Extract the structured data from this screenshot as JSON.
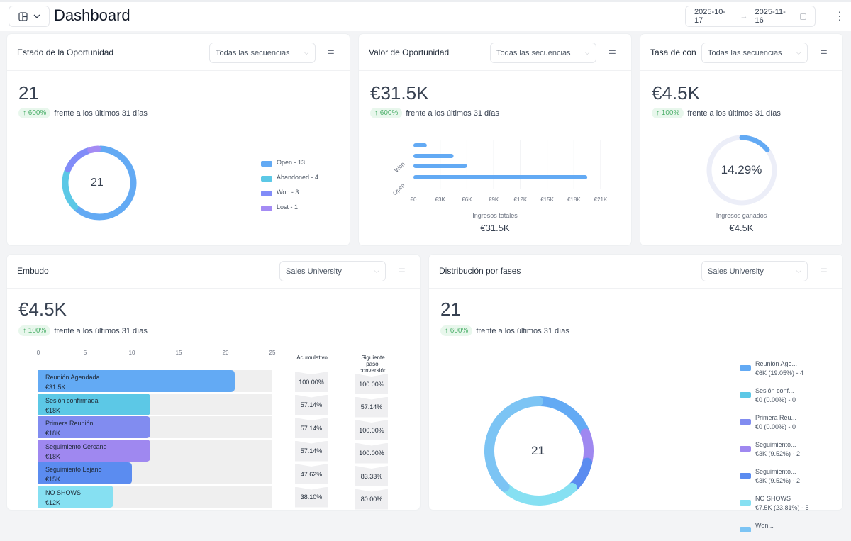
{
  "header": {
    "title": "Dashboard",
    "date_from": "2025-10-17",
    "date_to": "2025-11-16",
    "arrow": "→"
  },
  "icons": {
    "view": "layout-icon",
    "chevron": "chevron-down-icon",
    "calendar": "calendar-icon",
    "menu": "kebab-menu-icon",
    "settings": "sliders-icon"
  },
  "cards": {
    "status": {
      "title": "Estado de la Oportunidad",
      "select": "Todas las secuencias",
      "value": "21",
      "badge": "↑ 600%",
      "delta_text": "frente a los últimos 31 días",
      "center": "21"
    },
    "value": {
      "title": "Valor de Oportunidad",
      "select": "Todas las secuencias",
      "value": "€31.5K",
      "badge": "↑ 600%",
      "delta_text": "frente a los últimos 31 días",
      "footer_label": "Ingresos totales",
      "footer_value": "€31.5K"
    },
    "rate": {
      "title": "Tasa de con",
      "select": "Todas las secuencias",
      "value": "€4.5K",
      "badge": "↑ 100%",
      "delta_text": "frente a los últimos 31 días",
      "center": "14.29%",
      "footer_label": "Ingresos ganados",
      "footer_value": "€4.5K"
    },
    "funnel": {
      "title": "Embudo",
      "select": "Sales University",
      "value": "€4.5K",
      "badge": "↑ 100%",
      "delta_text": "frente a los últimos 31 días",
      "col_cum": "Acumulativo",
      "col_next": "Siguiente paso: conversión"
    },
    "phases": {
      "title": "Distribución por fases",
      "select": "Sales University",
      "value": "21",
      "badge": "↑ 600%",
      "delta_text": "frente a los últimos 31 días",
      "center": "21"
    }
  },
  "chart_data": [
    {
      "type": "pie",
      "title": "Estado de la Oportunidad",
      "center_label": "21",
      "labels": [
        "Open - 13",
        "Abandoned - 4",
        "Won - 3",
        "Lost - 1"
      ],
      "values": [
        13,
        4,
        3,
        1
      ],
      "colors": [
        "#63aaf4",
        "#5cc8e6",
        "#818cf8",
        "#a48bf4"
      ]
    },
    {
      "type": "bar",
      "orientation": "horizontal",
      "title": "Valor de Oportunidad",
      "categories": [
        "",
        "Won",
        "",
        "Open"
      ],
      "values": [
        1500,
        4500,
        6000,
        19500
      ],
      "xticks": [
        "€0",
        "€3K",
        "€6K",
        "€9K",
        "€12K",
        "€15K",
        "€18K",
        "€21K"
      ],
      "xlim": [
        0,
        21000
      ],
      "color": "#63aaf4"
    },
    {
      "type": "pie",
      "title": "Tasa de con",
      "center_label": "14.29%",
      "values": [
        14.29,
        85.71
      ],
      "colors": [
        "#63aaf4",
        "#eceef8"
      ]
    },
    {
      "type": "bar",
      "orientation": "horizontal",
      "title": "Embudo",
      "xticks": [
        "0",
        "5",
        "10",
        "15",
        "20",
        "25"
      ],
      "xlim": [
        0,
        25
      ],
      "stages": [
        {
          "name": "Reunión Agendada",
          "amount": "€31.5K",
          "count": 21,
          "cum": "100.00%",
          "next": "100.00%",
          "color": "#63aaf4"
        },
        {
          "name": "Sesión confirmada",
          "amount": "€18K",
          "count": 12,
          "cum": "57.14%",
          "next": "57.14%",
          "color": "#5cc8e6"
        },
        {
          "name": "Primera Reunión",
          "amount": "€18K",
          "count": 12,
          "cum": "57.14%",
          "next": "100.00%",
          "color": "#818cf0"
        },
        {
          "name": "Seguimiento Cercano",
          "amount": "€18K",
          "count": 12,
          "cum": "57.14%",
          "next": "100.00%",
          "color": "#9f88f0"
        },
        {
          "name": "Seguimiento Lejano",
          "amount": "€15K",
          "count": 10,
          "cum": "47.62%",
          "next": "83.33%",
          "color": "#5b8cf0"
        },
        {
          "name": "NO SHOWS",
          "amount": "€12K",
          "count": 8,
          "cum": "38.10%",
          "next": "80.00%",
          "color": "#86e0f2"
        }
      ]
    },
    {
      "type": "pie",
      "title": "Distribución por fases",
      "center_label": "21",
      "legend": [
        {
          "name": "Reunión Age...",
          "detail": "€6K (19.05%) - 4",
          "value": 4,
          "color": "#63aaf4"
        },
        {
          "name": "Sesión conf...",
          "detail": "€0 (0.00%) - 0",
          "value": 0,
          "color": "#5cc8e6"
        },
        {
          "name": "Primera Reu...",
          "detail": "€0 (0.00%) - 0",
          "value": 0,
          "color": "#818cf0"
        },
        {
          "name": "Seguimiento...",
          "detail": "€3K (9.52%) - 2",
          "value": 2,
          "color": "#9f88f0"
        },
        {
          "name": "Seguimiento...",
          "detail": "€3K (9.52%) - 2",
          "value": 2,
          "color": "#5b8cf0"
        },
        {
          "name": "NO SHOWS",
          "detail": "€7.5K (23.81%) - 5",
          "value": 5,
          "color": "#86e0f2"
        },
        {
          "name": "Won...",
          "detail": "",
          "value": 8,
          "color": "#7cc4f4"
        }
      ]
    }
  ]
}
